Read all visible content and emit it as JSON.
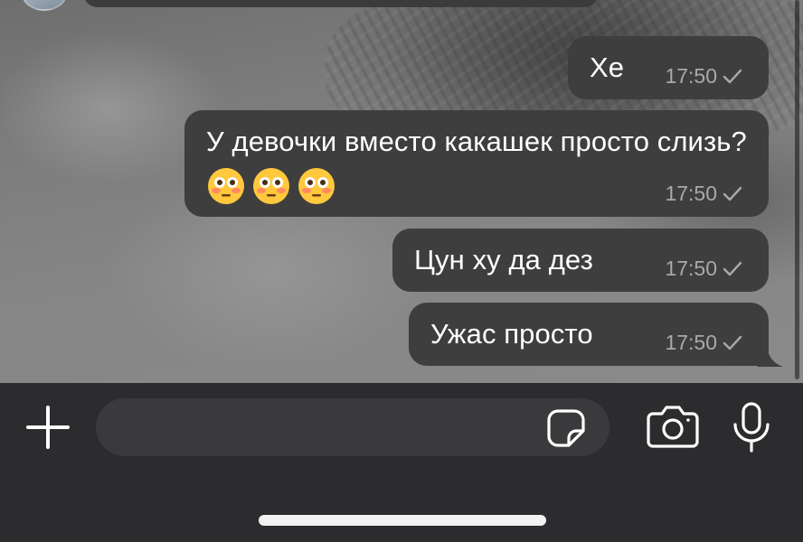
{
  "conversation": {
    "messages": [
      {
        "text": "Хе",
        "time": "17:50",
        "status": "sent"
      },
      {
        "text": "У девочки вместо какашек просто слизь?",
        "emoji": [
          "😳",
          "😳",
          "😳"
        ],
        "time": "17:50",
        "status": "sent"
      },
      {
        "text": "Цун ху да дез",
        "time": "17:50",
        "status": "sent"
      },
      {
        "text": "Ужас просто",
        "time": "17:50",
        "status": "sent"
      }
    ]
  },
  "composer": {
    "placeholder": "",
    "value": "",
    "icons": [
      "plus-icon",
      "sticker-icon",
      "camera-icon",
      "microphone-icon"
    ]
  },
  "colors": {
    "bubble": "#3e3e3e",
    "input_bar": "#2c2c2e",
    "input_field": "#3a3a3c",
    "meta_text": "#a9a9a9"
  }
}
